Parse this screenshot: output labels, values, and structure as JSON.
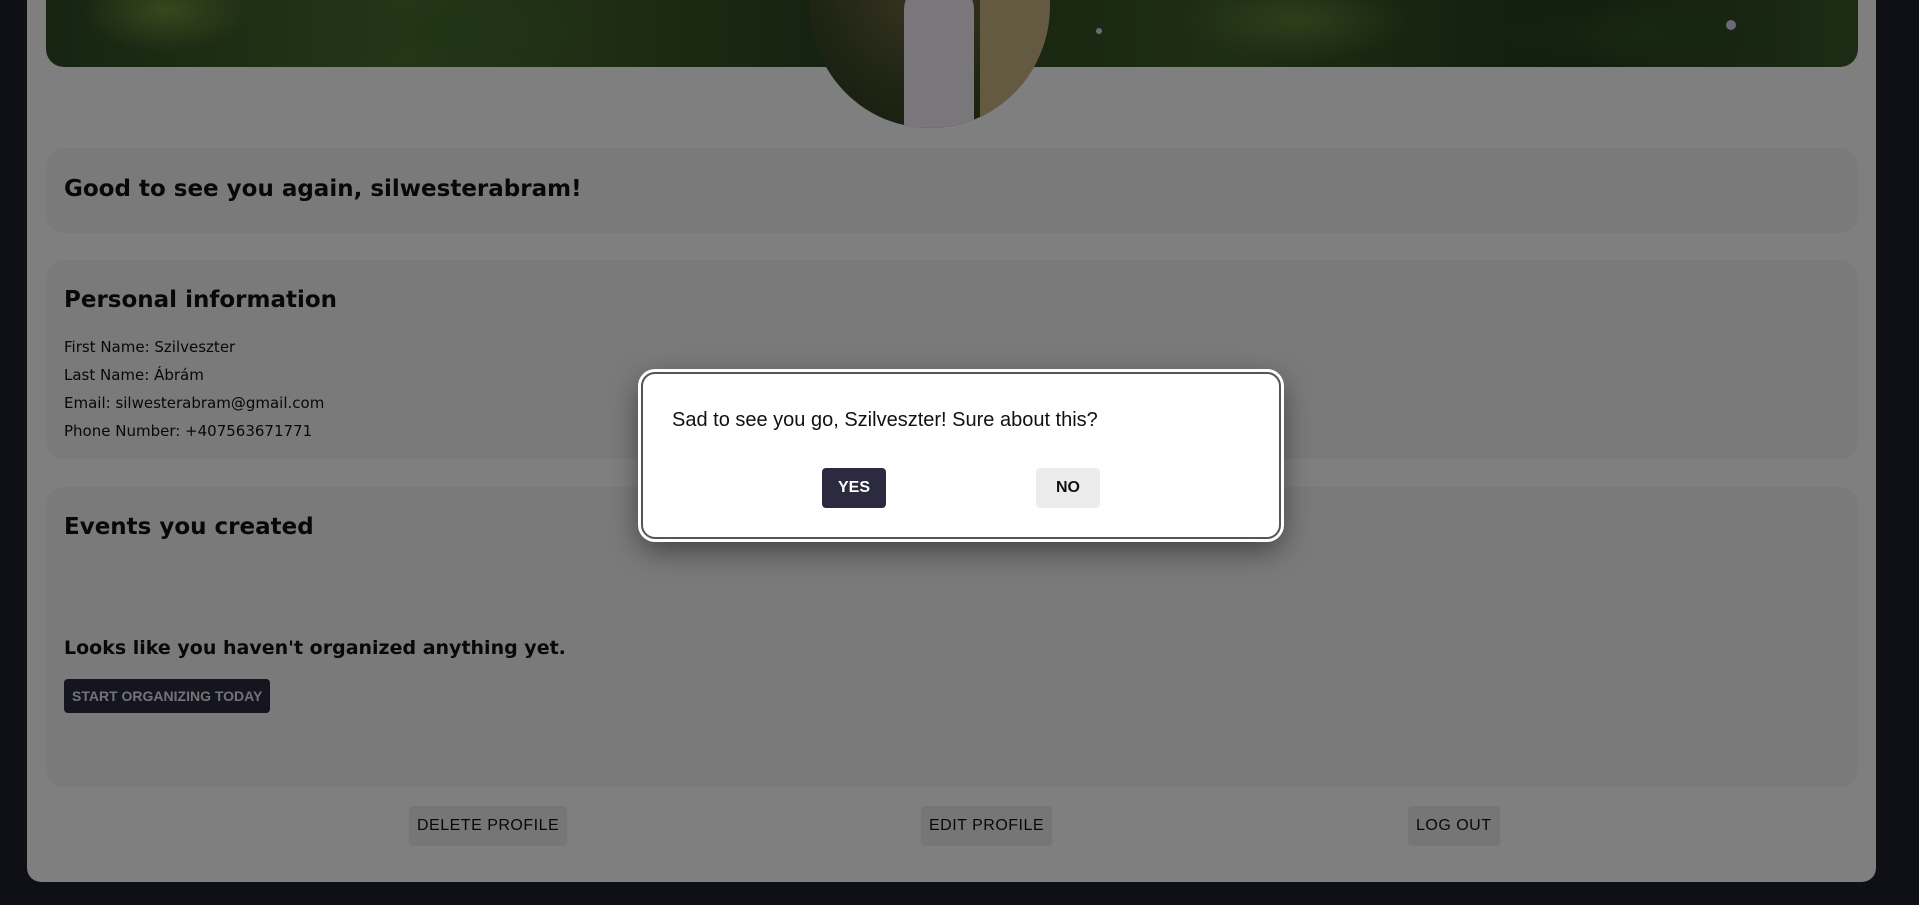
{
  "greeting": "Good to see you again, silwesterabram!",
  "personal": {
    "title": "Personal information",
    "first_name": "First Name: Szilveszter",
    "last_name": "Last Name: Ábrám",
    "email": "Email: silwesterabram@gmail.com",
    "phone": "Phone Number: +407563671771"
  },
  "events": {
    "title": "Events you created",
    "empty_message": "Looks like you haven't organized anything yet.",
    "cta_label": "START ORGANIZING TODAY"
  },
  "actions": {
    "delete_label": "DELETE PROFILE",
    "edit_label": "EDIT PROFILE",
    "logout_label": "LOG OUT"
  },
  "dialog": {
    "message": "Sad to see you go, Szilveszter! Sure about this?",
    "yes_label": "YES",
    "no_label": "NO"
  },
  "colors": {
    "page_background": "#1e1e2c",
    "card_background": "#ffffff",
    "panel_background": "#f4f4f4",
    "primary_button": "#2b2a3f",
    "secondary_button": "#ececec",
    "overlay": "rgba(0,0,0,0.5)"
  }
}
